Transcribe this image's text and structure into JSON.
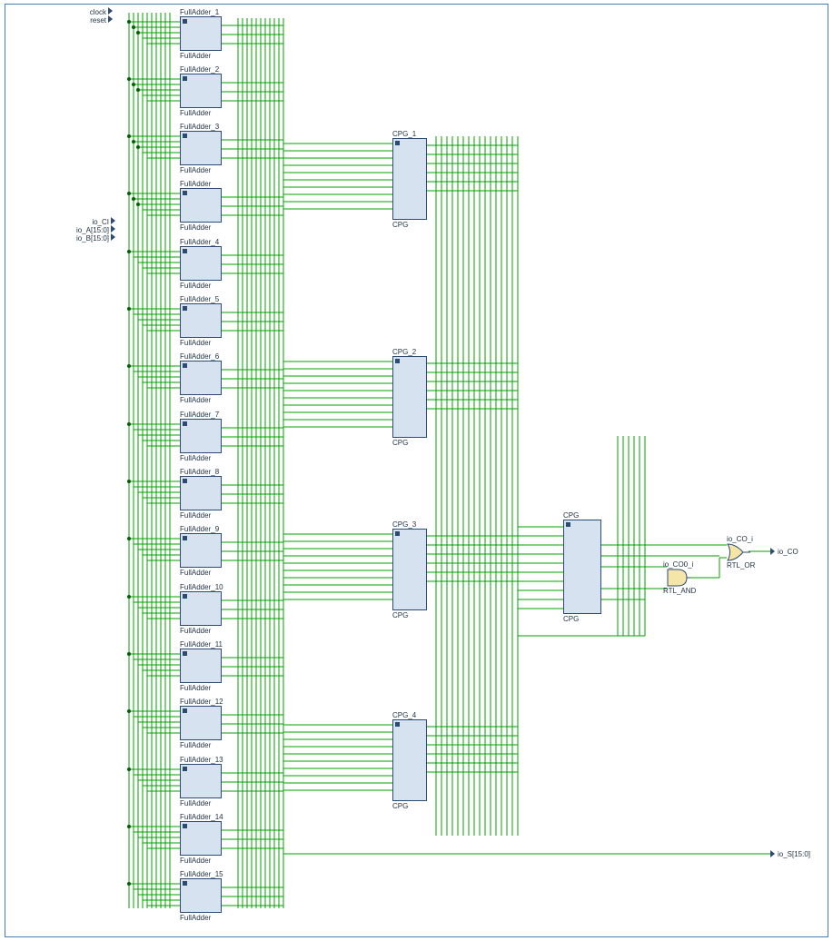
{
  "inputs": {
    "clock": "clock",
    "reset": "reset",
    "io_CI": "io_CI",
    "io_A": "io_A[15:0]",
    "io_B": "io_B[15:0]"
  },
  "outputs": {
    "io_CO": "io_CO",
    "io_S": "io_S[15:0]"
  },
  "gates": {
    "or": {
      "inst": "io_CO_i",
      "type": "RTL_OR"
    },
    "and": {
      "inst": "io_CO0_i",
      "type": "RTL_AND"
    }
  },
  "fulladders": [
    {
      "inst": "FullAdder_1",
      "type": "FullAdder"
    },
    {
      "inst": "FullAdder_2",
      "type": "FullAdder"
    },
    {
      "inst": "FullAdder_3",
      "type": "FullAdder"
    },
    {
      "inst": "FullAdder",
      "type": "FullAdder"
    },
    {
      "inst": "FullAdder_4",
      "type": "FullAdder"
    },
    {
      "inst": "FullAdder_5",
      "type": "FullAdder"
    },
    {
      "inst": "FullAdder_6",
      "type": "FullAdder"
    },
    {
      "inst": "FullAdder_7",
      "type": "FullAdder"
    },
    {
      "inst": "FullAdder_8",
      "type": "FullAdder"
    },
    {
      "inst": "FullAdder_9",
      "type": "FullAdder"
    },
    {
      "inst": "FullAdder_10",
      "type": "FullAdder"
    },
    {
      "inst": "FullAdder_11",
      "type": "FullAdder"
    },
    {
      "inst": "FullAdder_12",
      "type": "FullAdder"
    },
    {
      "inst": "FullAdder_13",
      "type": "FullAdder"
    },
    {
      "inst": "FullAdder_14",
      "type": "FullAdder"
    },
    {
      "inst": "FullAdder_15",
      "type": "FullAdder"
    }
  ],
  "cpg_units": [
    {
      "inst": "CPG_1",
      "type": "CPG"
    },
    {
      "inst": "CPG_2",
      "type": "CPG"
    },
    {
      "inst": "CPG_3",
      "type": "CPG"
    },
    {
      "inst": "CPG_4",
      "type": "CPG"
    }
  ],
  "cpg_final": {
    "inst": "CPG",
    "type": "CPG"
  },
  "meta": {
    "description": "RTL schematic of a 16-bit carry-lookahead adder. Sixteen FullAdder instances feed four CPG (carry-propagate-generate) blocks, which feed a fifth CPG. The final CPG plus an RTL_AND and RTL_OR gate compute io_CO. io_S[15:0] is the sum bus output."
  }
}
